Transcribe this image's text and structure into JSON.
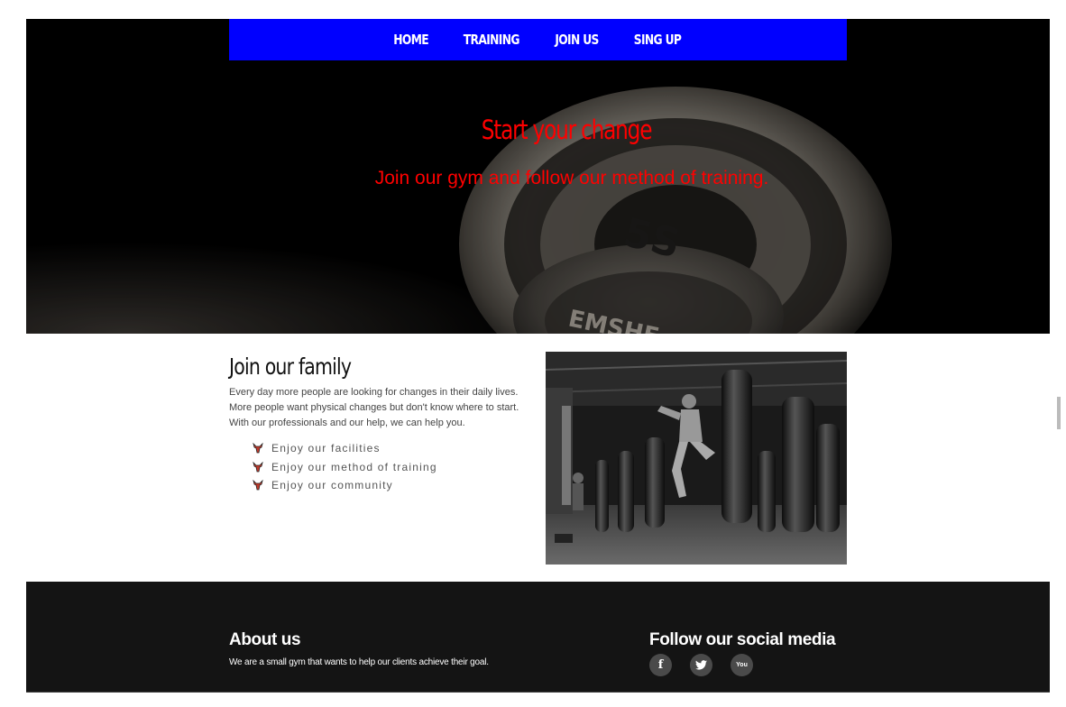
{
  "nav": {
    "items": [
      {
        "label": "HOME"
      },
      {
        "label": "TRAINING"
      },
      {
        "label": "JOIN US"
      },
      {
        "label": "SING UP"
      }
    ],
    "color": "#0000ff"
  },
  "hero": {
    "title": "Start your change",
    "subtitle": "Join our gym and follow our method of training.",
    "accent_color": "#ff0000",
    "image": "weight-plate-photo"
  },
  "main": {
    "title": "Join our family",
    "text": "Every day more people are looking for changes in their daily lives. More people want physical changes but don't know where to start. With our professionals and our help, we can help you.",
    "list": [
      {
        "label": "Enjoy our facilities",
        "icon": "bull-icon"
      },
      {
        "label": "Enjoy our method of training",
        "icon": "bull-icon"
      },
      {
        "label": "Enjoy our community",
        "icon": "bull-icon"
      }
    ],
    "image": "gym-boxing-photo"
  },
  "footer": {
    "about_title": "About us",
    "about_text": "We are a small gym that wants to help our clients achieve their goal.",
    "social_title": "Follow our social media",
    "social": [
      {
        "icon": "facebook-icon",
        "glyph": "f"
      },
      {
        "icon": "twitter-icon",
        "glyph": "t"
      },
      {
        "icon": "youtube-icon",
        "glyph": "You"
      }
    ]
  }
}
